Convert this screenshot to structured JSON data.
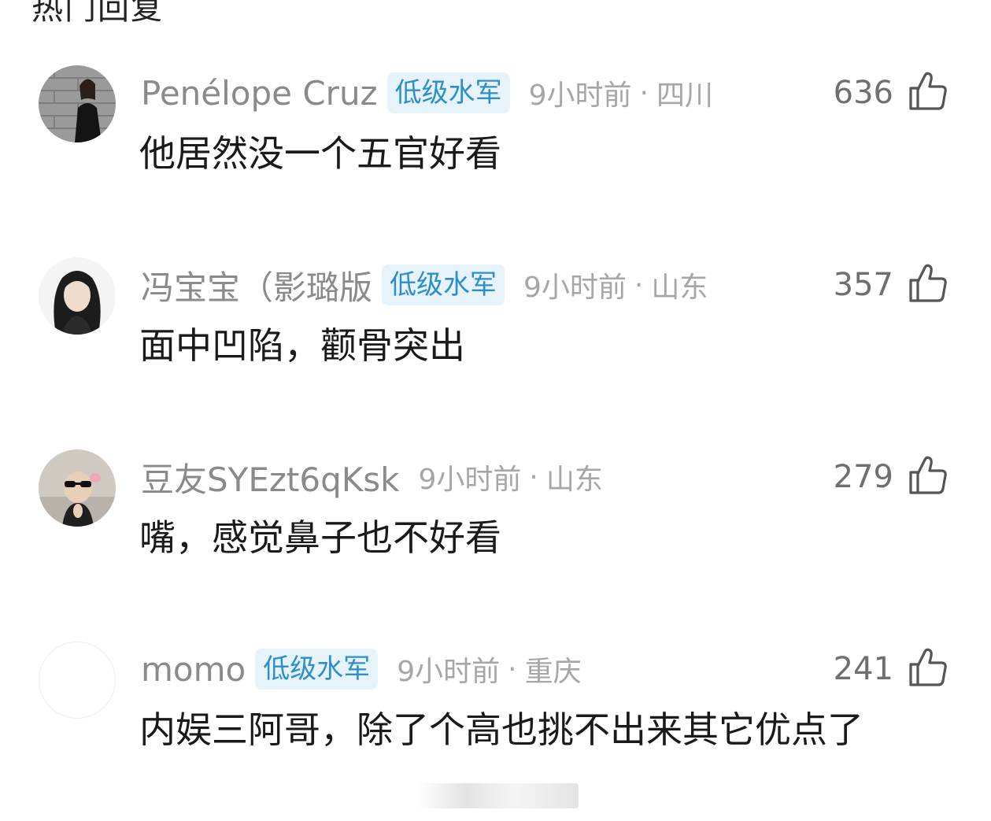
{
  "section": {
    "title": "热门回复"
  },
  "comments": [
    {
      "username": "Penélope Cruz",
      "badge": "低级水军",
      "time": "9小时前",
      "separator": "·",
      "location": "四川",
      "likes": "636",
      "text": "他居然没一个五官好看"
    },
    {
      "username": "冯宝宝（影璐版",
      "badge": "低级水军",
      "time": "9小时前",
      "separator": "·",
      "location": "山东",
      "likes": "357",
      "text": "面中凹陷，颧骨突出"
    },
    {
      "username": "豆友SYEzt6qKsk",
      "time": "9小时前",
      "separator": "·",
      "location": "山东",
      "likes": "279",
      "text": "嘴，感觉鼻子也不好看"
    },
    {
      "username": "momo",
      "badge": "低级水军",
      "time": "9小时前",
      "separator": "·",
      "location": "重庆",
      "likes": "241",
      "text": "内娱三阿哥，除了个高也挑不出来其它优点了"
    }
  ],
  "icons": {
    "like": "thumbs-up-icon"
  },
  "colors": {
    "badge_bg": "#e6f3fb",
    "badge_text": "#2e8fc8",
    "meta_text": "#a6a6a6",
    "username_text": "#8a8a8a"
  }
}
